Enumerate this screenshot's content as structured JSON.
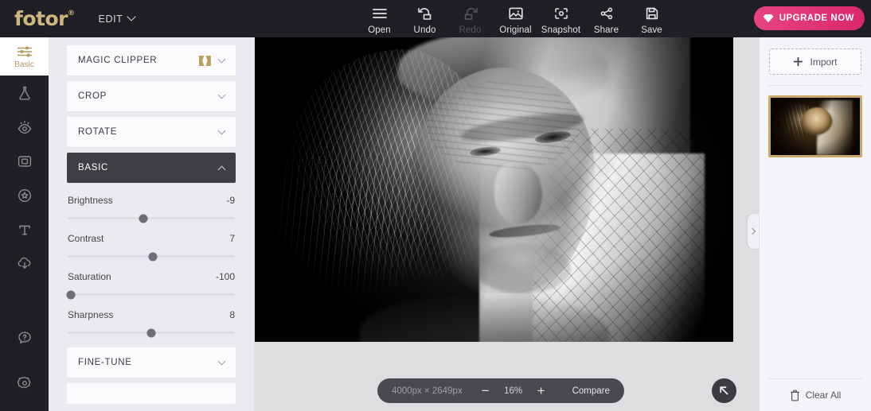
{
  "app": {
    "logo": "fotor",
    "logo_trademark": "®",
    "edit_menu": "EDIT",
    "brand_gold": "#cdb77f",
    "accent_pink": "#e8447e"
  },
  "toolbar": {
    "items": [
      {
        "label": "Open",
        "icon": "hamburger-menu-icon",
        "disabled": false
      },
      {
        "label": "Undo",
        "icon": "undo-arrow-icon",
        "disabled": false
      },
      {
        "label": "Redo",
        "icon": "redo-arrow-icon",
        "disabled": true
      },
      {
        "label": "Original",
        "icon": "image-icon",
        "disabled": false
      },
      {
        "label": "Snapshot",
        "icon": "focus-frame-icon",
        "disabled": false
      },
      {
        "label": "Share",
        "icon": "share-nodes-icon",
        "disabled": false
      },
      {
        "label": "Save",
        "icon": "floppy-disk-icon",
        "disabled": false
      }
    ],
    "upgrade_label": "UPGRADE NOW",
    "upgrade_icon": "diamond-icon"
  },
  "sidebar": {
    "items": [
      {
        "label": "Basic",
        "icon": "sliders-icon",
        "active": true
      },
      {
        "label": "",
        "icon": "flask-effects-icon",
        "active": false
      },
      {
        "label": "",
        "icon": "eye-beauty-icon",
        "active": false
      },
      {
        "label": "",
        "icon": "frame-icon",
        "active": false
      },
      {
        "label": "",
        "icon": "sticker-icon",
        "active": false
      },
      {
        "label": "",
        "icon": "text-icon",
        "active": false
      },
      {
        "label": "",
        "icon": "cloud-upload-icon",
        "active": false
      }
    ],
    "bottom_items": [
      {
        "label": "",
        "icon": "help-question-icon"
      },
      {
        "label": "",
        "icon": "settings-gear-icon"
      }
    ]
  },
  "panel": {
    "sections": [
      {
        "title": "MAGIC CLIPPER",
        "expanded": false,
        "premium": true
      },
      {
        "title": "CROP",
        "expanded": false,
        "premium": false
      },
      {
        "title": "ROTATE",
        "expanded": false,
        "premium": false
      },
      {
        "title": "BASIC",
        "expanded": true,
        "premium": false
      }
    ],
    "sliders": [
      {
        "name": "Brightness",
        "value": "-9",
        "pct": 45
      },
      {
        "name": "Contrast",
        "value": "7",
        "pct": 51
      },
      {
        "name": "Saturation",
        "value": "-100",
        "pct": 2
      },
      {
        "name": "Sharpness",
        "value": "8",
        "pct": 50
      }
    ],
    "footer_sections": [
      {
        "title": "FINE-TUNE",
        "expanded": false
      }
    ]
  },
  "status": {
    "dimensions": "4000px × 2649px",
    "zoom_out": "−",
    "zoom_level": "16%",
    "zoom_in": "+",
    "compare": "Compare",
    "fit_icon": "arrow-up-left-icon"
  },
  "right": {
    "import_label": "Import",
    "import_icon": "plus-icon",
    "clear_all_label": "Clear All",
    "clear_all_icon": "trash-icon",
    "thumbnail_selected": true,
    "collapse_icon": "chevron-right-icon"
  }
}
